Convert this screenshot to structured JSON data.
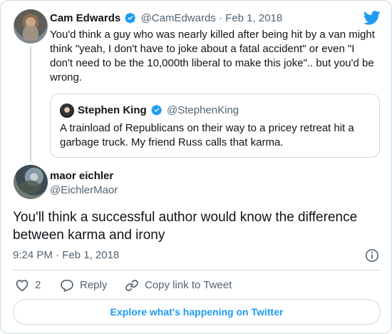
{
  "brand": {
    "logo_icon": "twitter-bird-icon",
    "accent_color": "#1d9bf0",
    "verified_color": "#1d9bf0"
  },
  "parent_tweet": {
    "author_name": "Cam Edwards",
    "author_handle": "@CamEdwards",
    "separator": "·",
    "date": "Feb 1, 2018",
    "text": "You'd think a guy who was nearly killed after being hit by a van might think \"yeah, I don't have to joke about a fatal accident\" or even \"I don't need to be the 10,000th liberal to make this joke\".. but you'd be wrong.",
    "verified_icon": "verified-badge-icon"
  },
  "quoted_tweet": {
    "author_name": "Stephen King",
    "author_handle": "@StephenKing",
    "text": "A trainload of Republicans on their way to a pricey retreat hit a garbage truck. My friend Russ calls that karma.",
    "verified_icon": "verified-badge-icon"
  },
  "main_tweet": {
    "author_name": "maor eichler",
    "author_handle": "@EichlerMaor",
    "text": "You'll think a successful author would know the difference between karma and irony",
    "timestamp": "9:24 PM · Feb 1, 2018",
    "info_icon": "info-icon"
  },
  "actions": {
    "like_count": "2",
    "like_icon": "heart-icon",
    "reply_label": "Reply",
    "reply_icon": "reply-bubble-icon",
    "copy_label": "Copy link to Tweet",
    "copy_icon": "link-icon"
  },
  "footer": {
    "explore_label": "Explore what's happening on Twitter"
  }
}
